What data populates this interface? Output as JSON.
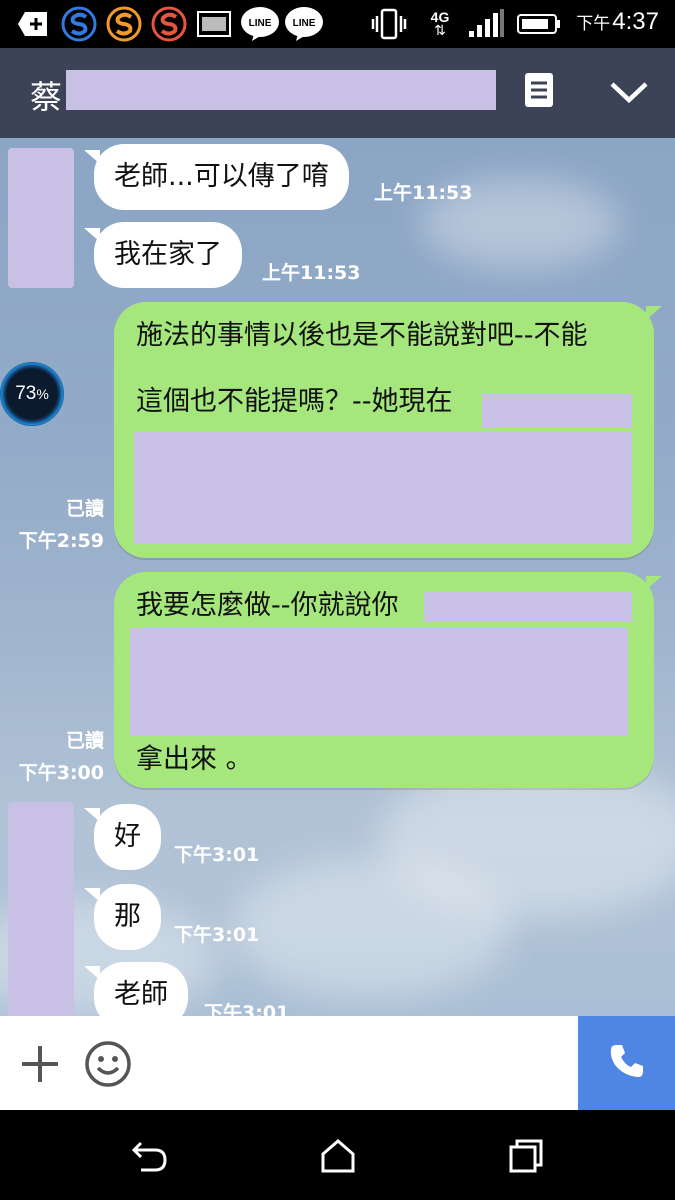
{
  "status_bar": {
    "time_prefix": "下午",
    "time": "4:37",
    "network": "4G",
    "icons": [
      "add-icon",
      "s-app-icon-blue",
      "s-app-icon-orange",
      "s-app-icon-red",
      "gallery-icon",
      "line-icon",
      "line-icon",
      "vibrate-icon",
      "network-4g-icon",
      "signal-icon",
      "battery-icon"
    ],
    "line_badge": "LINE"
  },
  "header": {
    "title": "蔡",
    "icons": [
      "menu-doc-icon",
      "chevron-down-icon"
    ]
  },
  "battery_overlay": {
    "value": "73",
    "unit": "%"
  },
  "messages": [
    {
      "side": "in",
      "text": "老師...可以傳了唷",
      "time": "上午11:53"
    },
    {
      "side": "in",
      "text": "我在家了",
      "time": "上午11:53"
    },
    {
      "side": "out",
      "line1": "施法的事情以後也是不能說對吧--不能",
      "line2": "這個也不能提嗎？--她現在",
      "read": "已讀",
      "time": "下午2:59"
    },
    {
      "side": "out",
      "line1": "我要怎麼做--你就說你",
      "line3": "拿出來 。",
      "read": "已讀",
      "time": "下午3:00"
    },
    {
      "side": "in",
      "text": "好",
      "time": "下午3:01"
    },
    {
      "side": "in",
      "text": "那",
      "time": "下午3:01"
    },
    {
      "side": "in",
      "text": "老師",
      "time": "下午3:01"
    }
  ],
  "input_bar": {
    "icons": [
      "plus-icon",
      "emoji-icon",
      "phone-icon"
    ]
  },
  "nav_bar": {
    "icons": [
      "back-icon",
      "home-icon",
      "recents-icon"
    ]
  },
  "colors": {
    "header_bg": "#3c4356",
    "outgoing_bubble": "#a5e77d",
    "incoming_bubble": "#ffffff",
    "call_button": "#4f86e4",
    "redaction": "#c9c0e6"
  }
}
